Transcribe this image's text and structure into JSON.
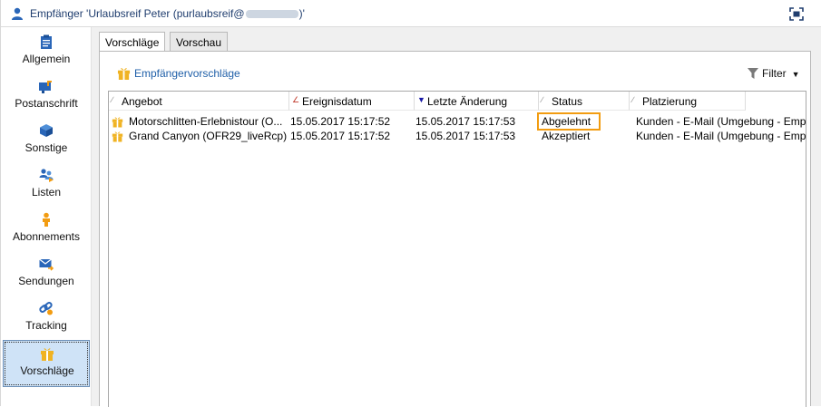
{
  "window": {
    "title_prefix": "Empfänger 'Urlaubsreif Peter (purlaubsreif@",
    "title_suffix": ")'",
    "person_icon": "person-icon",
    "maximize_icon": "maximize-icon"
  },
  "sidebar": {
    "items": [
      {
        "label": "Allgemein",
        "icon": "clipboard-icon",
        "active": false
      },
      {
        "label": "Postanschrift",
        "icon": "mailbox-icon",
        "active": false
      },
      {
        "label": "Sonstige",
        "icon": "cube-icon",
        "active": false
      },
      {
        "label": "Listen",
        "icon": "people-list-icon",
        "active": false
      },
      {
        "label": "Abonnements",
        "icon": "subscriber-icon",
        "active": false
      },
      {
        "label": "Sendungen",
        "icon": "envelope-send-icon",
        "active": false
      },
      {
        "label": "Tracking",
        "icon": "tracking-link-icon",
        "active": false
      },
      {
        "label": "Vorschläge",
        "icon": "gift-icon",
        "active": true
      }
    ]
  },
  "tabs": [
    {
      "label": "Vorschläge",
      "active": true
    },
    {
      "label": "Vorschau",
      "active": false
    }
  ],
  "toolbar": {
    "title": "Empfängervorschläge",
    "filter_label": "Filter"
  },
  "table": {
    "columns": [
      {
        "label": "Angebot",
        "sort": "none"
      },
      {
        "label": "Ereignisdatum",
        "sort": "none"
      },
      {
        "label": "Letzte Änderung",
        "sort": "desc"
      },
      {
        "label": "Status",
        "sort": "none"
      },
      {
        "label": "Platzierung",
        "sort": "none"
      }
    ],
    "rows": [
      {
        "angebot": "Motorschlitten-Erlebnistour (O...",
        "ereignisdatum": "15.05.2017 15:17:52",
        "letzte_aenderung": "15.05.2017 15:17:53",
        "status": "Abgelehnt",
        "platzierung": "Kunden - E-Mail (Umgebung - Empf"
      },
      {
        "angebot": "Grand Canyon (OFR29_liveRcp)",
        "ereignisdatum": "15.05.2017 15:17:52",
        "letzte_aenderung": "15.05.2017 15:17:53",
        "status": "Akzeptiert",
        "platzierung": "Kunden - E-Mail (Umgebung - Empf"
      }
    ]
  },
  "colors": {
    "accent_blue": "#1f5fa8",
    "highlight_orange": "#f29c11",
    "gift_yellow": "#f0b323",
    "active_nav_bg": "#cfe3f7"
  }
}
